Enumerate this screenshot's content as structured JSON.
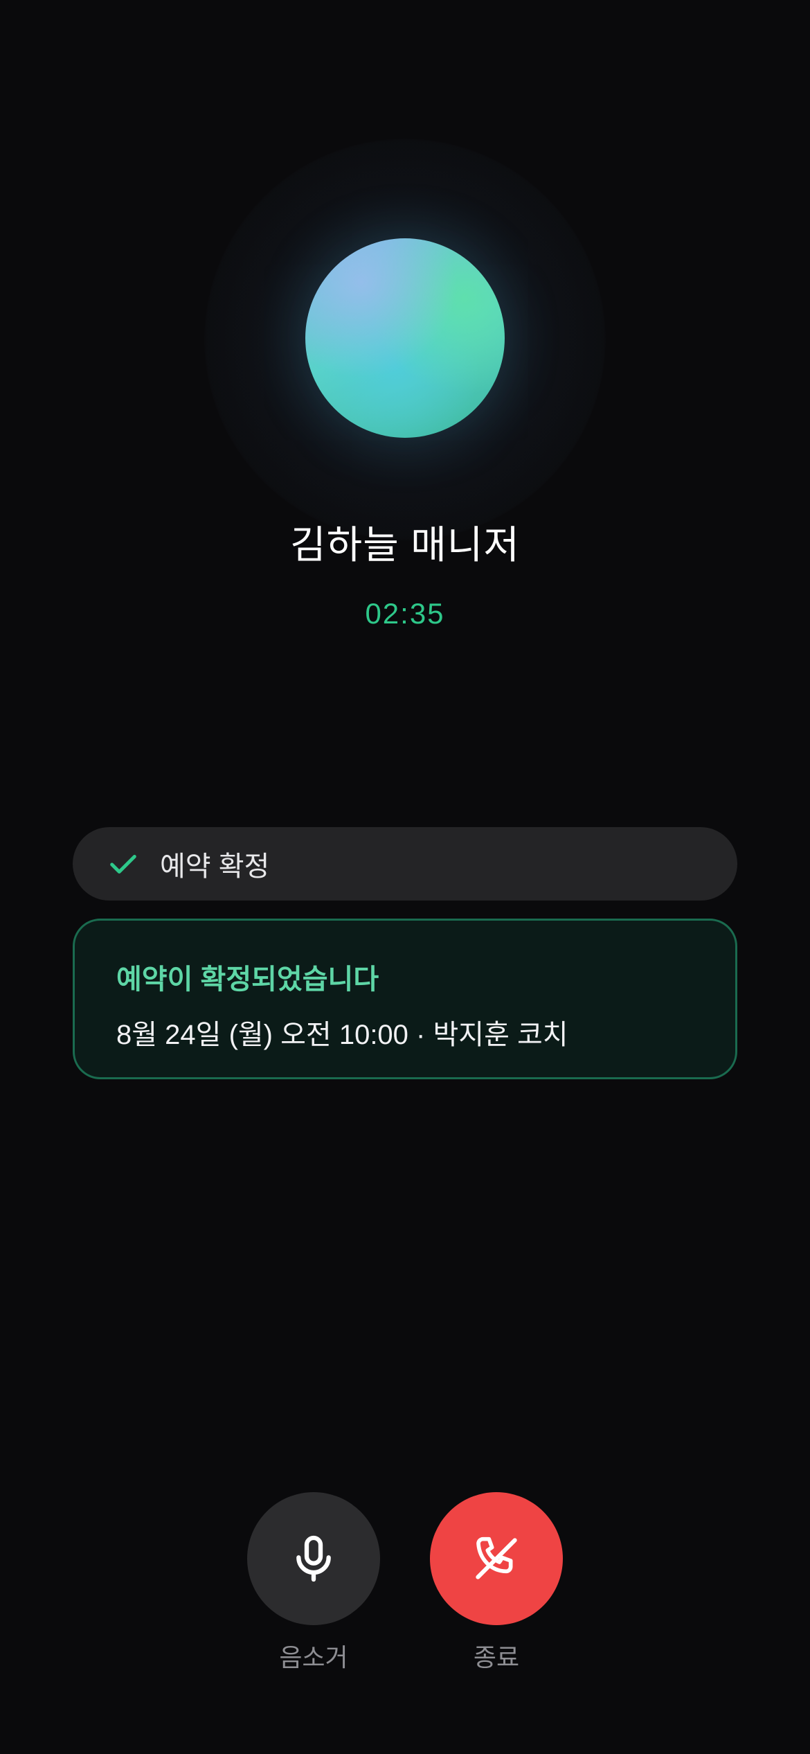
{
  "call": {
    "caller_name": "김하늘 매니저",
    "timer": "02:35"
  },
  "status_pill": {
    "icon": "check-icon",
    "label": "예약 확정"
  },
  "confirmation": {
    "title": "예약이 확정되었습니다",
    "detail": "8월 24일 (월) 오전 10:00 · 박지훈 코치"
  },
  "controls": {
    "mute": {
      "icon": "microphone-icon",
      "label": "음소거"
    },
    "end": {
      "icon": "phone-hangup-icon",
      "label": "종료"
    }
  },
  "colors": {
    "background": "#0a0a0c",
    "accent_green": "#2ec88a",
    "card_title_green": "#5ed6a6",
    "card_border": "#1a6b4f",
    "end_call_red": "#ef4444",
    "mute_button": "#2c2c2e"
  }
}
